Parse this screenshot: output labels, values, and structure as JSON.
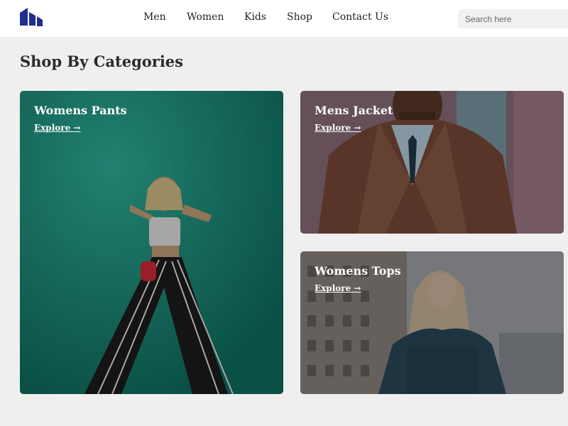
{
  "nav": {
    "links": [
      "Men",
      "Women",
      "Kids",
      "Shop",
      "Contact Us"
    ],
    "search_placeholder": "Search here"
  },
  "page": {
    "heading": "Shop By Categories"
  },
  "categories": [
    {
      "title": "Womens Pants",
      "link": "Explore →"
    },
    {
      "title": "Mens Jacket",
      "link": "Explore →"
    },
    {
      "title": "Womens Tops",
      "link": "Explore →"
    }
  ],
  "colors": {
    "brand": "#1f2f8f",
    "teal": "#14917f",
    "jacket": "#7a4a38",
    "denim": "#2a4a5a"
  }
}
